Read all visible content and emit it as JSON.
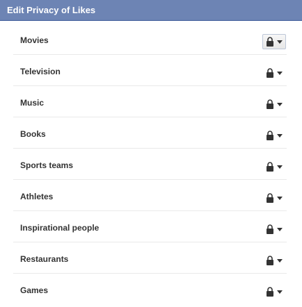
{
  "dialog": {
    "title": "Edit Privacy of Likes"
  },
  "categories": [
    {
      "label": "Movies",
      "privacy_icon": "lock-icon",
      "active": true
    },
    {
      "label": "Television",
      "privacy_icon": "lock-icon",
      "active": false
    },
    {
      "label": "Music",
      "privacy_icon": "lock-icon",
      "active": false
    },
    {
      "label": "Books",
      "privacy_icon": "lock-icon",
      "active": false
    },
    {
      "label": "Sports teams",
      "privacy_icon": "lock-icon",
      "active": false
    },
    {
      "label": "Athletes",
      "privacy_icon": "lock-icon",
      "active": false
    },
    {
      "label": "Inspirational people",
      "privacy_icon": "lock-icon",
      "active": false
    },
    {
      "label": "Restaurants",
      "privacy_icon": "lock-icon",
      "active": false
    },
    {
      "label": "Games",
      "privacy_icon": "lock-icon",
      "active": false
    }
  ],
  "colors": {
    "header_bg": "#6d84b4",
    "header_border": "#3b5998",
    "label_text": "#333333",
    "icon": "#333333"
  }
}
